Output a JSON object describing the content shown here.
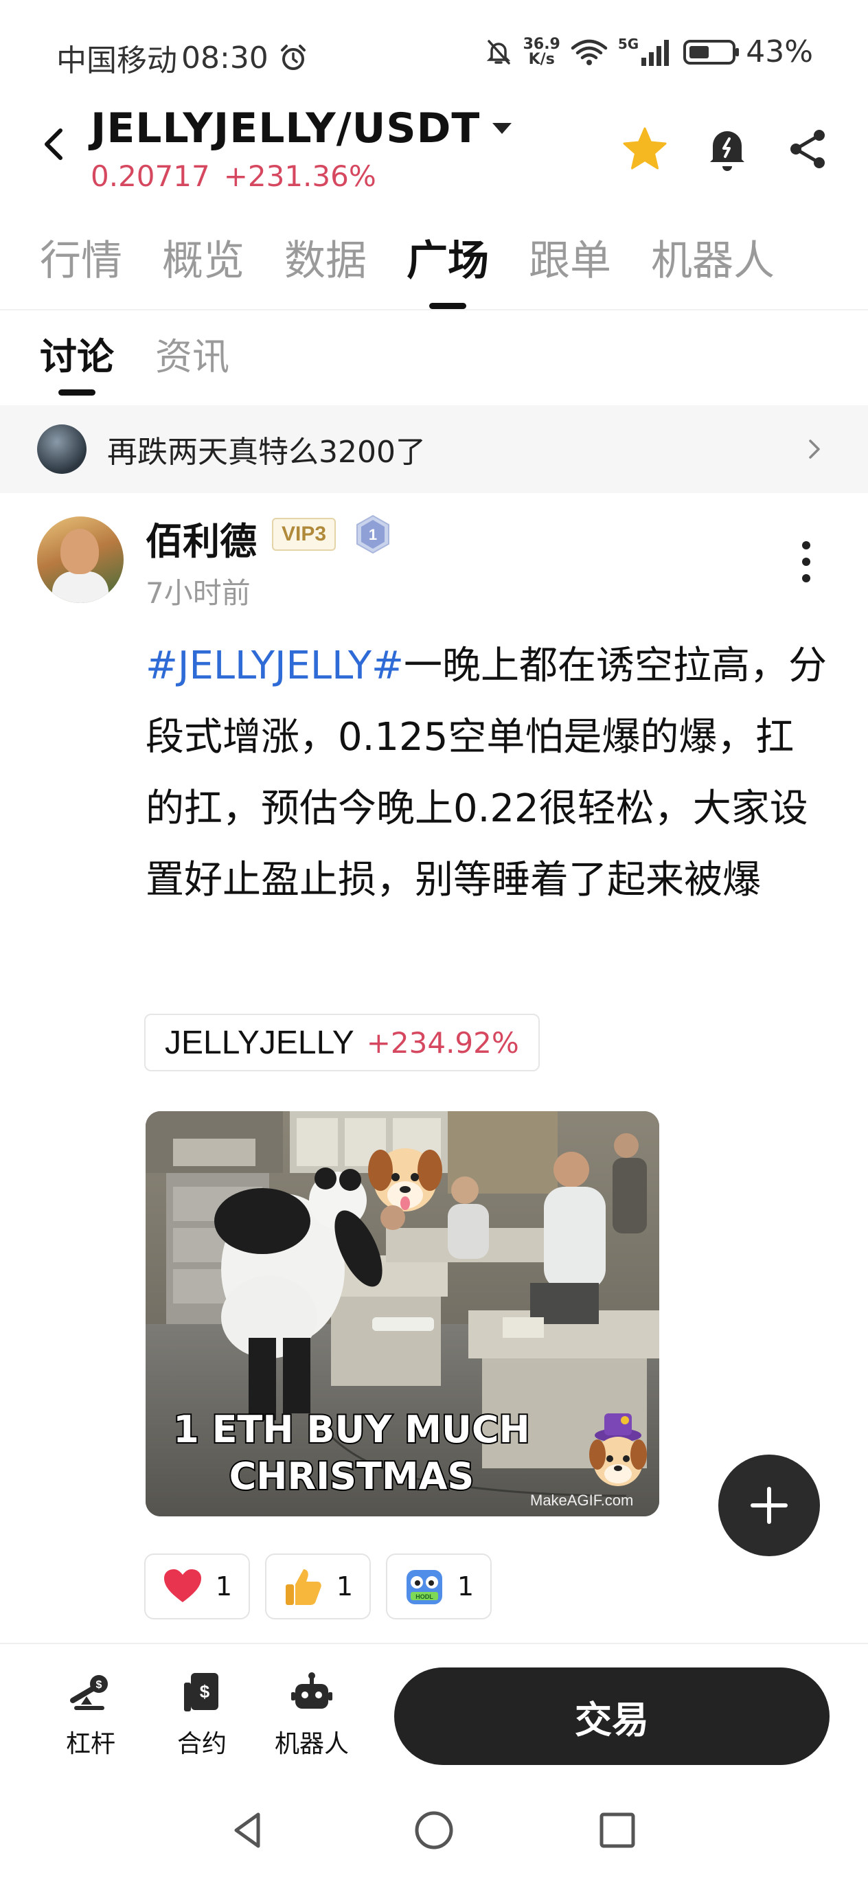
{
  "status_bar": {
    "carrier": "中国移动",
    "time": "08:30",
    "net_speed_value": "36.9",
    "net_speed_unit": "K/s",
    "network": "5G",
    "battery": "43%"
  },
  "header": {
    "pair": "JELLYJELLY/USDT",
    "price": "0.20717",
    "change": "+231.36%"
  },
  "main_tabs": [
    {
      "label": "行情",
      "active": false
    },
    {
      "label": "概览",
      "active": false
    },
    {
      "label": "数据",
      "active": false
    },
    {
      "label": "广场",
      "active": true
    },
    {
      "label": "跟单",
      "active": false
    },
    {
      "label": "机器人",
      "active": false
    }
  ],
  "sub_tabs": [
    {
      "label": "讨论",
      "active": true
    },
    {
      "label": "资讯",
      "active": false
    }
  ],
  "pinned": {
    "text": "再跌两天真特么3200了"
  },
  "post": {
    "author": "佰利德",
    "vip": "VIP3",
    "level": "1",
    "time": "7小时前",
    "hashtag": "#JELLYJELLY#",
    "body": "一晚上都在诱空拉高，分段式增涨，0.125空单怕是爆的爆，扛的扛，预估今晚上0.22很轻松，大家设置好止盈止损，别等睡着了起来被爆",
    "coin_tag": {
      "name": "JELLYJELLY",
      "change": "+234.92%"
    },
    "image": {
      "caption_line1": "1 ETH BUY MUCH",
      "caption_line2": "CHRISTMAS",
      "watermark": "MakeAGIF.com",
      "sticker_label": "HODL"
    },
    "reactions": [
      {
        "icon": "heart-icon",
        "count": "1"
      },
      {
        "icon": "thumbs-up-icon",
        "count": "1"
      },
      {
        "icon": "hodl-robot-icon",
        "count": "1"
      }
    ]
  },
  "bottom_nav": {
    "items": [
      {
        "label": "杠杆",
        "icon": "leverage-icon"
      },
      {
        "label": "合约",
        "icon": "contract-icon"
      },
      {
        "label": "机器人",
        "icon": "robot-icon"
      }
    ],
    "trade_label": "交易"
  },
  "colors": {
    "price_red": "#d6485f",
    "hashtag_blue": "#2f6bd6",
    "star_yellow": "#f5b820",
    "dark_button": "#232323"
  }
}
